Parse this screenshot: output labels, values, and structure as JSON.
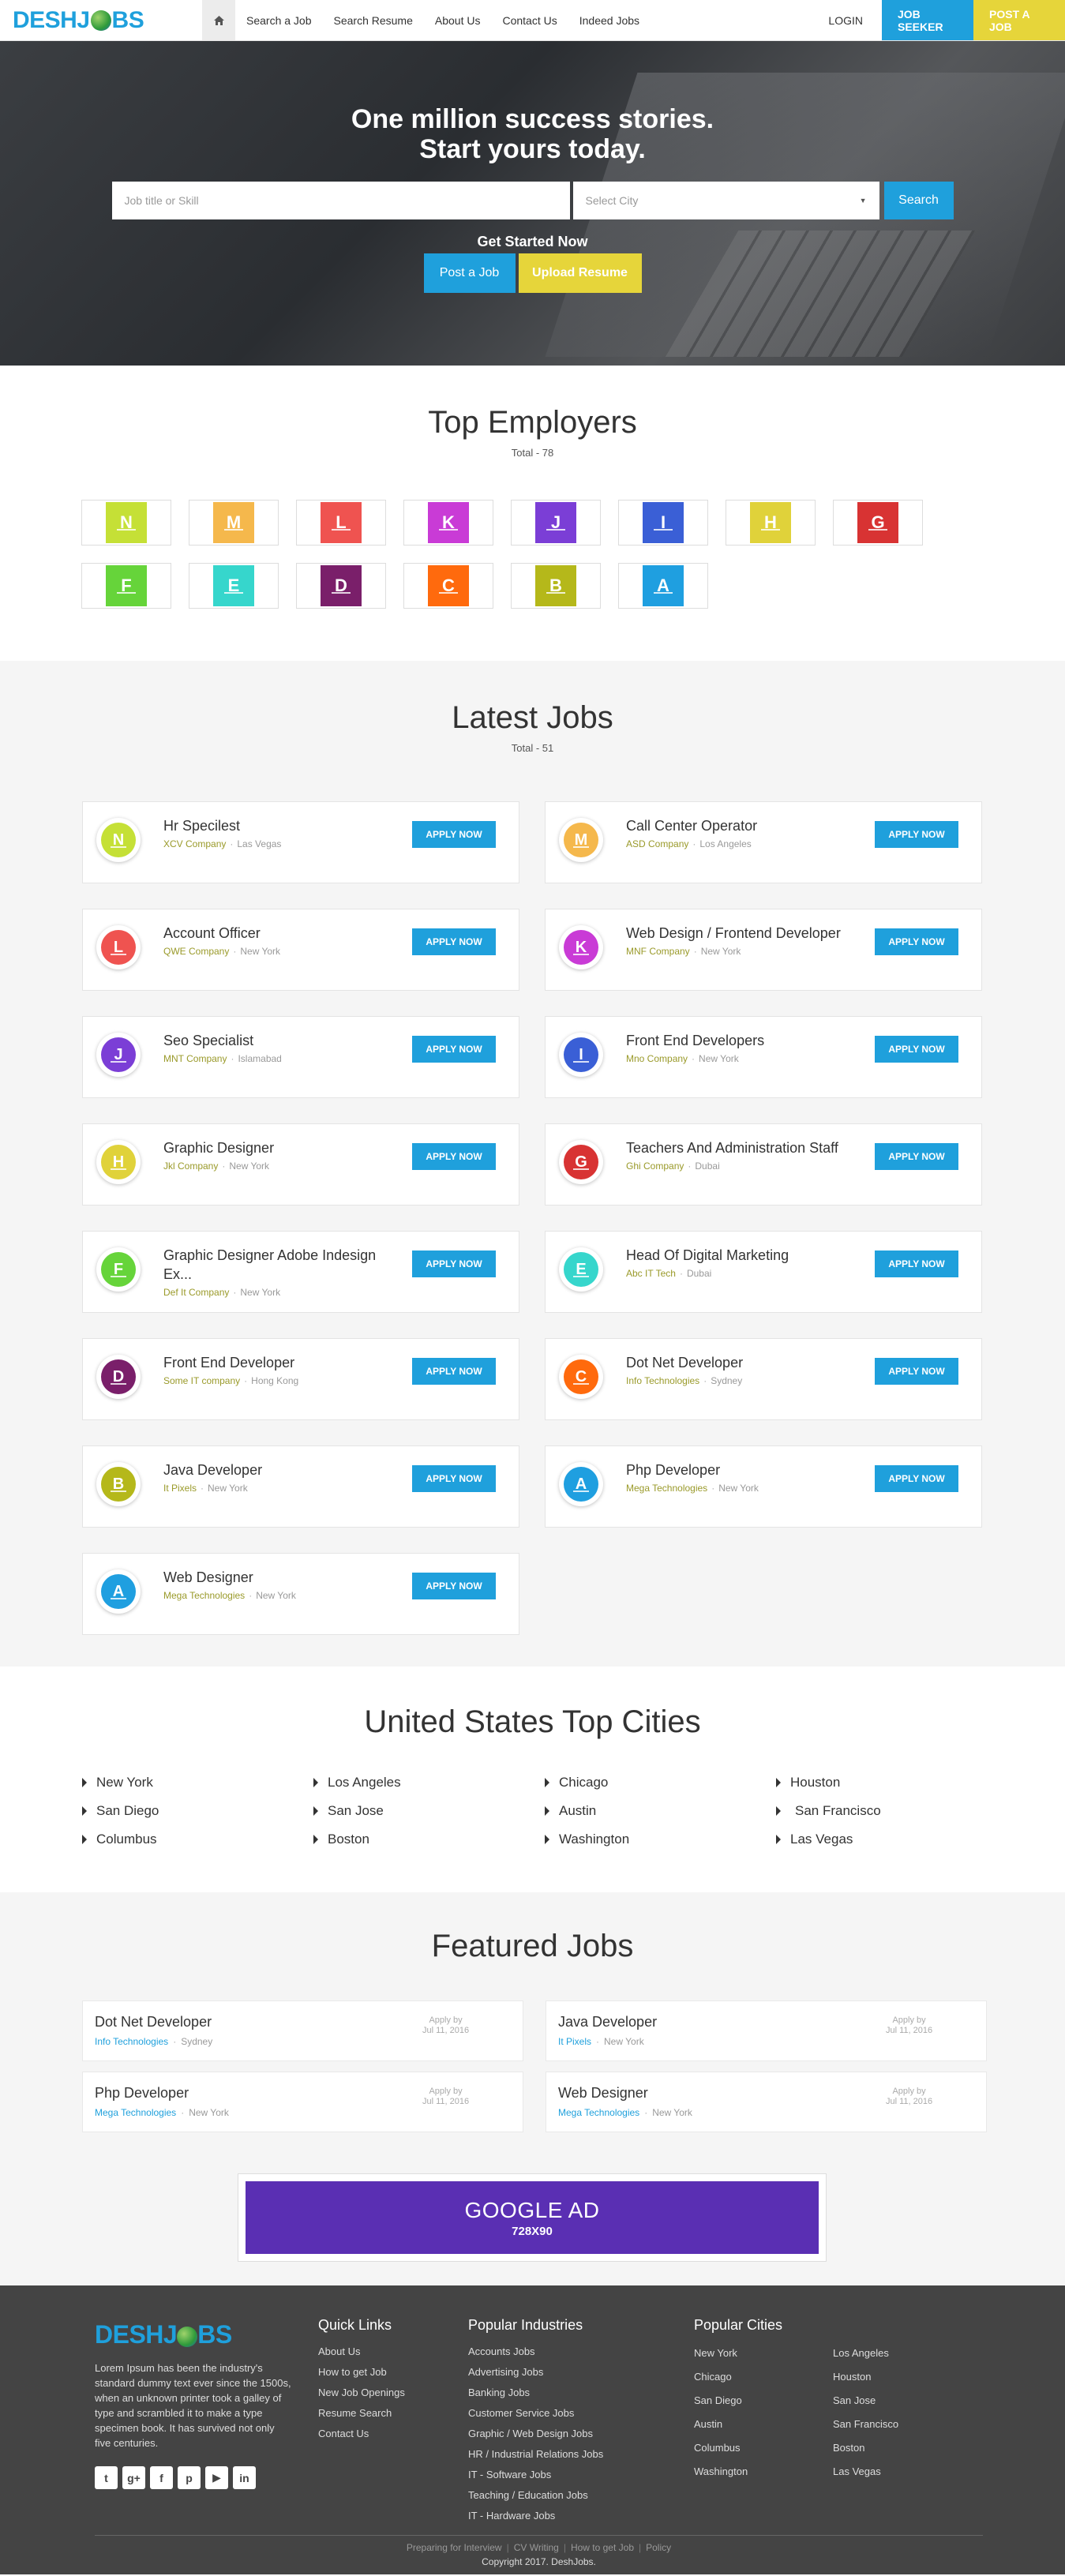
{
  "nav": {
    "logo_left": "DESH",
    "logo_right": "BS",
    "home_icon": "home-icon",
    "items": [
      "Search a Job",
      "Search Resume",
      "About Us",
      "Contact Us",
      "Indeed Jobs"
    ],
    "login": "LOGIN",
    "job_seeker": "JOB SEEKER",
    "post_a_job": "POST A JOB"
  },
  "hero": {
    "headline_1": "One million success stories.",
    "headline_2": "Start yours today.",
    "skill_placeholder": "Job title or Skill",
    "city_placeholder": "Select City",
    "search_label": "Search",
    "get_started": "Get Started Now",
    "post_job_label": "Post a Job",
    "upload_resume_label": "Upload Resume"
  },
  "employers": {
    "title": "Top Employers",
    "subtitle": "Total - 78",
    "items": [
      {
        "letter": "N",
        "color": "#c5e036"
      },
      {
        "letter": "M",
        "color": "#f5b84c"
      },
      {
        "letter": "L",
        "color": "#ef5350"
      },
      {
        "letter": "K",
        "color": "#c93bd6"
      },
      {
        "letter": "J",
        "color": "#7b3ed6"
      },
      {
        "letter": "I",
        "color": "#3a5fd6"
      },
      {
        "letter": "H",
        "color": "#e0d23a"
      },
      {
        "letter": "G",
        "color": "#d83333"
      },
      {
        "letter": "F",
        "color": "#66d43a"
      },
      {
        "letter": "E",
        "color": "#36d6cc"
      },
      {
        "letter": "D",
        "color": "#7a1f6a"
      },
      {
        "letter": "C",
        "color": "#ff6a0d"
      },
      {
        "letter": "B",
        "color": "#b5b81a"
      },
      {
        "letter": "A",
        "color": "#1f9fe0"
      }
    ]
  },
  "latest": {
    "title": "Latest Jobs",
    "subtitle": "Total - 51",
    "apply_label": "APPLY NOW",
    "jobs": [
      {
        "letter": "N",
        "color": "#c5e036",
        "title": "Hr Specilest",
        "company": "XCV Company",
        "location": "Las Vegas"
      },
      {
        "letter": "M",
        "color": "#f5b84c",
        "title": "Call Center Operator",
        "company": "ASD Company",
        "location": "Los Angeles"
      },
      {
        "letter": "L",
        "color": "#ef5350",
        "title": "Account Officer",
        "company": "QWE Company",
        "location": "New York"
      },
      {
        "letter": "K",
        "color": "#c93bd6",
        "title": "Web Design / Frontend Developer",
        "company": "MNF Company",
        "location": "New York"
      },
      {
        "letter": "J",
        "color": "#7b3ed6",
        "title": "Seo Specialist",
        "company": "MNT Company",
        "location": "Islamabad"
      },
      {
        "letter": "I",
        "color": "#3a5fd6",
        "title": "Front End Developers",
        "company": "Mno Company",
        "location": "New York"
      },
      {
        "letter": "H",
        "color": "#e0d23a",
        "title": "Graphic Designer",
        "company": "Jkl Company",
        "location": "New York"
      },
      {
        "letter": "G",
        "color": "#d83333",
        "title": "Teachers And Administration Staff",
        "company": "Ghi Company",
        "location": "Dubai"
      },
      {
        "letter": "F",
        "color": "#66d43a",
        "title": "Graphic Designer Adobe Indesign Ex...",
        "company": "Def It Company",
        "location": "New York"
      },
      {
        "letter": "E",
        "color": "#36d6cc",
        "title": "Head Of Digital Marketing",
        "company": "Abc IT Tech",
        "location": "Dubai"
      },
      {
        "letter": "D",
        "color": "#7a1f6a",
        "title": "Front End Developer",
        "company": "Some IT company",
        "location": "Hong Kong"
      },
      {
        "letter": "C",
        "color": "#ff6a0d",
        "title": "Dot Net Developer",
        "company": "Info Technologies",
        "location": "Sydney"
      },
      {
        "letter": "B",
        "color": "#b5b81a",
        "title": "Java Developer",
        "company": "It Pixels",
        "location": "New York"
      },
      {
        "letter": "A",
        "color": "#1f9fe0",
        "title": "Php Developer",
        "company": "Mega Technologies",
        "location": "New York"
      },
      {
        "letter": "A",
        "color": "#1f9fe0",
        "title": "Web Designer",
        "company": "Mega Technologies",
        "location": "New York"
      }
    ]
  },
  "cities": {
    "title": "United States Top Cities",
    "items": [
      "New York",
      "Los Angeles",
      "Chicago",
      "Houston",
      "San Diego",
      "San Jose",
      "Austin",
      "San Francisco",
      "Columbus",
      "Boston",
      "Washington",
      "Las Vegas"
    ]
  },
  "featured": {
    "title": "Featured Jobs",
    "jobs": [
      {
        "title": "Dot Net Developer",
        "company": "Info Technologies",
        "location": "Sydney",
        "apply_by": "Apply by",
        "date": "Jul 11, 2016"
      },
      {
        "title": "Java Developer",
        "company": "It Pixels",
        "location": "New York",
        "apply_by": "Apply by",
        "date": "Jul 11, 2016"
      },
      {
        "title": "Php Developer",
        "company": "Mega Technologies",
        "location": "New York",
        "apply_by": "Apply by",
        "date": "Jul 11, 2016"
      },
      {
        "title": "Web Designer",
        "company": "Mega Technologies",
        "location": "New York",
        "apply_by": "Apply by",
        "date": "Jul 11, 2016"
      }
    ],
    "ad_title": "GOOGLE AD",
    "ad_size": "728X90"
  },
  "footer": {
    "logo_left": "DESH",
    "logo_right": "BS",
    "about": "Lorem Ipsum has been the industry's standard dummy text ever since the 1500s, when an unknown printer took a galley of type and scrambled it to make a type specimen book. It has survived not only five centuries.",
    "socials": [
      {
        "icon": "twitter-icon",
        "glyph": "t"
      },
      {
        "icon": "google-plus-icon",
        "glyph": "g+"
      },
      {
        "icon": "facebook-icon",
        "glyph": "f"
      },
      {
        "icon": "pinterest-icon",
        "glyph": "p"
      },
      {
        "icon": "youtube-icon",
        "glyph": "▶"
      },
      {
        "icon": "linkedin-icon",
        "glyph": "in"
      }
    ],
    "quick_links_title": "Quick Links",
    "quick_links": [
      "About Us",
      "How to get Job",
      "New Job Openings",
      "Resume Search",
      "Contact Us"
    ],
    "industries_title": "Popular Industries",
    "industries": [
      "Accounts Jobs",
      "Advertising Jobs",
      "Banking Jobs",
      "Customer Service Jobs",
      "Graphic / Web Design Jobs",
      "HR / Industrial Relations Jobs",
      "IT - Software Jobs",
      "Teaching / Education Jobs",
      "IT - Hardware Jobs"
    ],
    "cities_title": "Popular Cities",
    "cities": [
      "New York",
      "Los Angeles",
      "Chicago",
      "Houston",
      "San Diego",
      "San Jose",
      "Austin",
      "San Francisco",
      "Columbus",
      "Boston",
      "Washington",
      "Las Vegas"
    ],
    "bottom_links": [
      "Preparing for Interview",
      "CV Writing",
      "How to get Job",
      "Policy"
    ],
    "copyright": "Copyright 2017. DeshJobs."
  }
}
